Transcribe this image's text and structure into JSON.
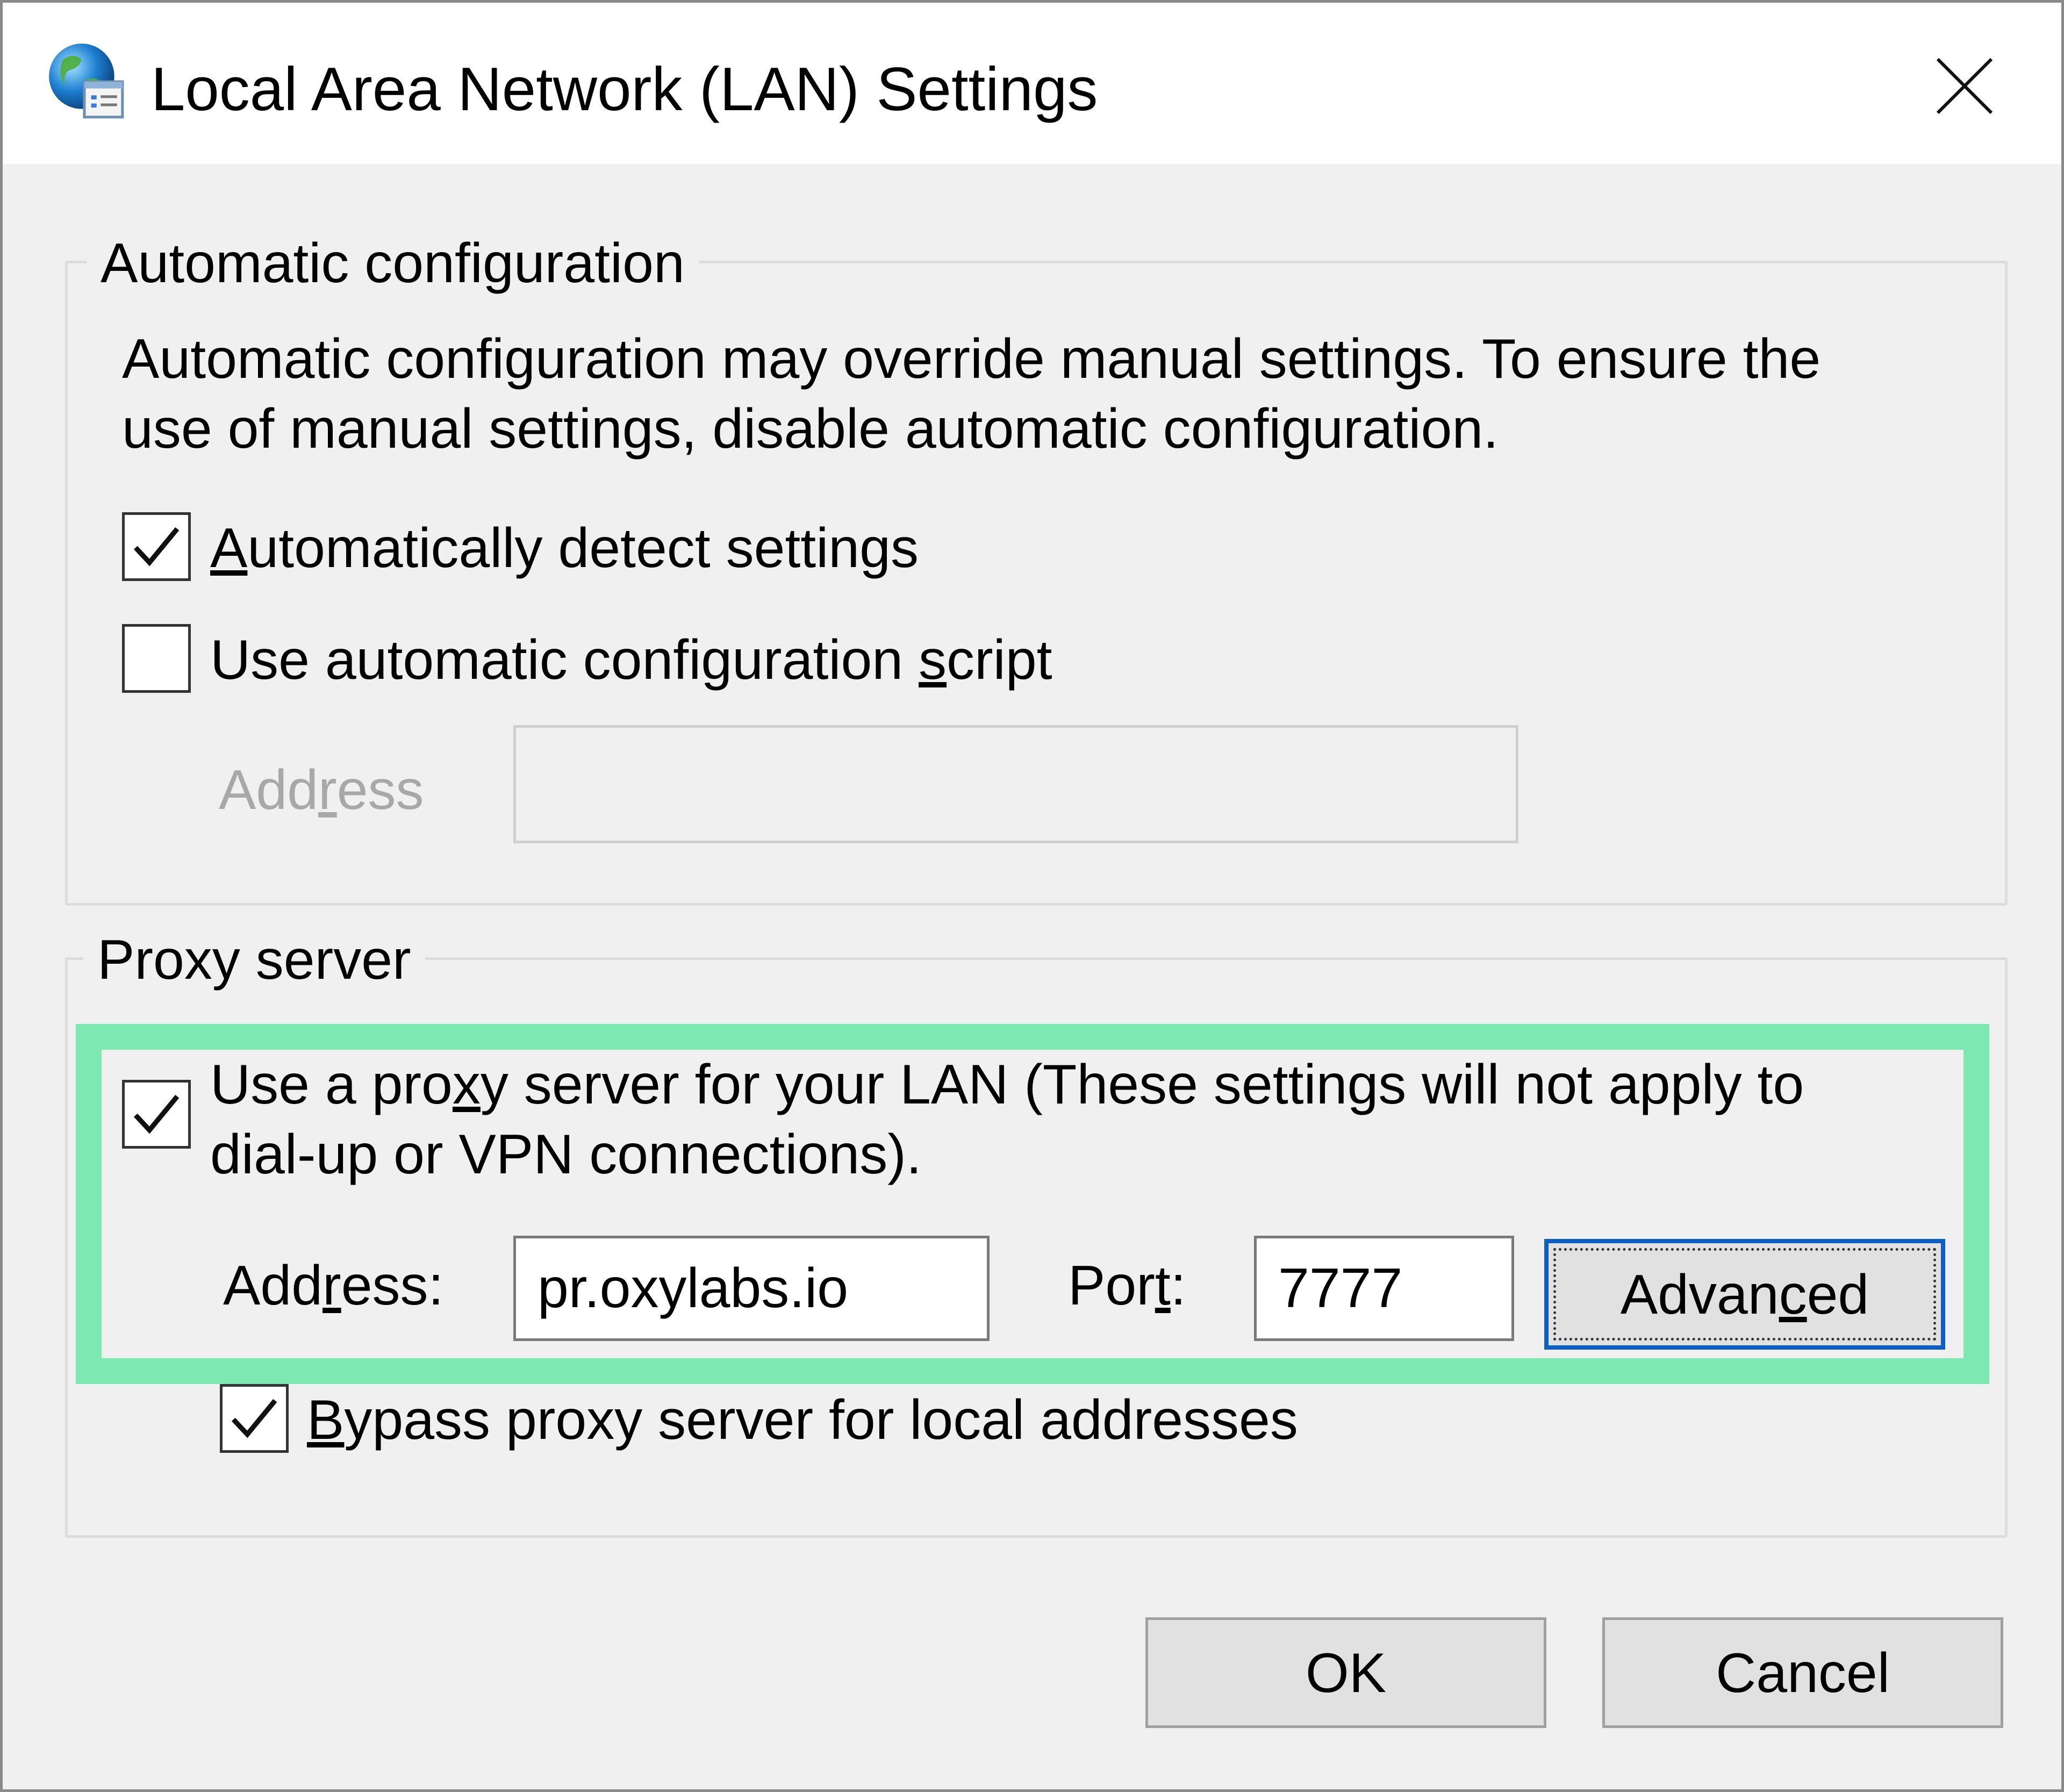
{
  "window": {
    "title": "Local Area Network (LAN) Settings",
    "icon": "internet-options-globe-icon"
  },
  "automatic_configuration": {
    "legend": "Automatic configuration",
    "description_line1": "Automatic configuration may override manual settings.  To ensure the",
    "description_line2": "use of manual settings, disable automatic configuration.",
    "detect_settings": {
      "label_mnemonic": "A",
      "label_rest": "utomatically detect settings",
      "checked": true
    },
    "use_script": {
      "label_before": "Use automatic configuration ",
      "label_mnemonic": "s",
      "label_after": "cript",
      "checked": false
    },
    "address": {
      "label_before": "Add",
      "label_mnemonic": "r",
      "label_after": "ess",
      "value": "",
      "enabled": false
    }
  },
  "proxy_server": {
    "legend": "Proxy server",
    "use_proxy": {
      "line1_before": "Use a pro",
      "line1_mnemonic": "x",
      "line1_after": "y server for your LAN (These settings will not apply to",
      "line2": "dial-up or VPN connections).",
      "checked": true
    },
    "address": {
      "label_before": "Add",
      "label_mnemonic": "r",
      "label_after": "ess:",
      "value": "pr.oxylabs.io"
    },
    "port": {
      "label_before": "Por",
      "label_mnemonic": "t",
      "label_after": ":",
      "value": "7777"
    },
    "advanced_button": {
      "label_before": "Advan",
      "label_mnemonic": "c",
      "label_after": "ed"
    },
    "bypass_local": {
      "label_mnemonic": "B",
      "label_rest": "ypass proxy server for local addresses",
      "checked": true
    }
  },
  "buttons": {
    "ok": "OK",
    "cancel": "Cancel"
  },
  "colors": {
    "highlight": "#7ee8b2",
    "default_button_border": "#0b5fc6",
    "dialog_background": "#f0f0f0"
  }
}
